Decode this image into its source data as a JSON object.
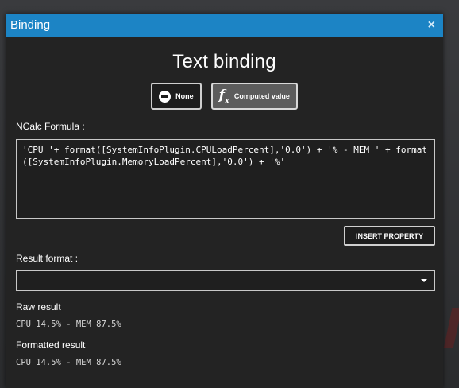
{
  "dialog": {
    "title": "Binding",
    "close_glyph": "×",
    "heading": "Text binding"
  },
  "modes": {
    "none_label": "None",
    "computed_label": "Computed value",
    "active": "computed"
  },
  "formula": {
    "label": "NCalc Formula :",
    "value": "'CPU '+ format([SystemInfoPlugin.CPULoadPercent],'0.0') + '% - MEM ' + format([SystemInfoPlugin.MemoryLoadPercent],'0.0') + '%'"
  },
  "insert_property_label": "INSERT PROPERTY",
  "result_format": {
    "label": "Result format :",
    "selected": ""
  },
  "raw_result": {
    "label": "Raw result",
    "value": "CPU 14.5% - MEM 87.5%"
  },
  "formatted_result": {
    "label": "Formatted result",
    "value": "CPU 14.5% - MEM 87.5%"
  },
  "colors": {
    "titlebar": "#1c84c5",
    "dialog_bg": "#232323"
  }
}
